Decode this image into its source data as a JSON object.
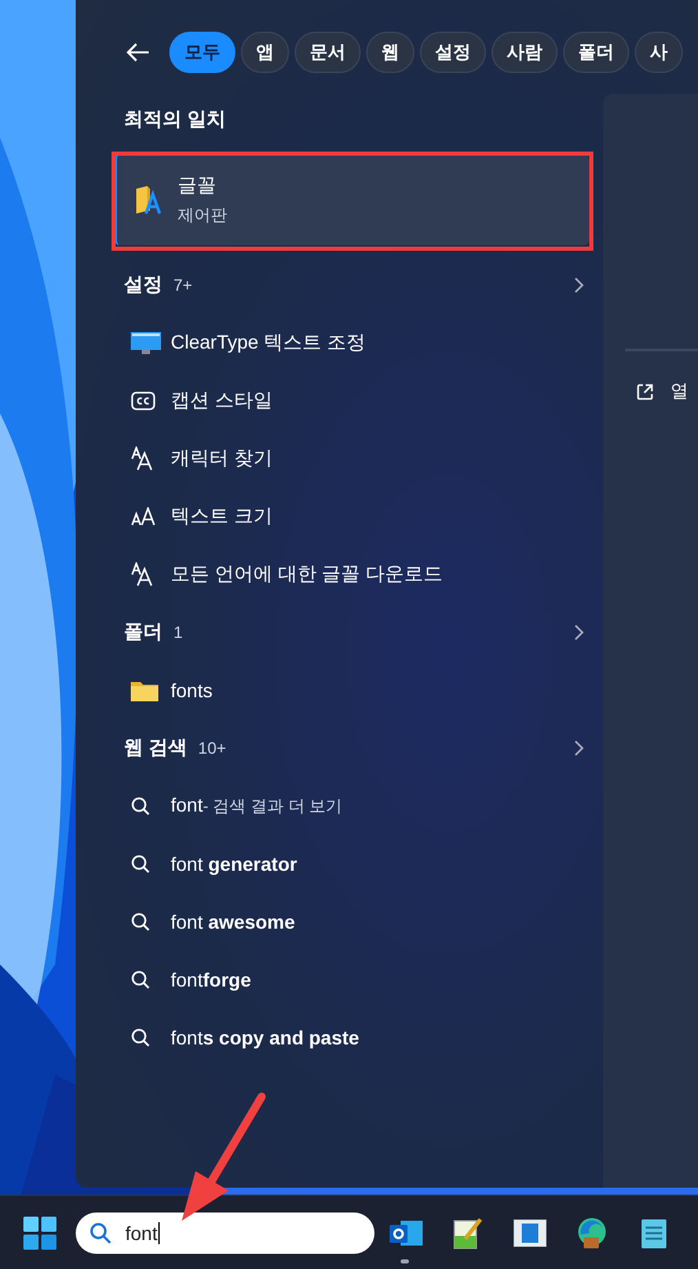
{
  "filters": [
    {
      "label": "모두",
      "selected": true
    },
    {
      "label": "앱",
      "selected": false
    },
    {
      "label": "문서",
      "selected": false
    },
    {
      "label": "웹",
      "selected": false
    },
    {
      "label": "설정",
      "selected": false
    },
    {
      "label": "사람",
      "selected": false
    },
    {
      "label": "폴더",
      "selected": false
    },
    {
      "label": "사",
      "selected": false
    }
  ],
  "best_match": {
    "heading": "최적의 일치",
    "title": "글꼴",
    "subtitle": "제어판"
  },
  "sections": [
    {
      "heading": "설정",
      "count": "7+",
      "items": [
        {
          "kind": "monitor",
          "label": "ClearType 텍스트 조정"
        },
        {
          "kind": "captions",
          "label": "캡션 스타일"
        },
        {
          "kind": "font",
          "label": "캐릭터 찾기"
        },
        {
          "kind": "font-size",
          "label": "텍스트 크기"
        },
        {
          "kind": "font",
          "label": "모든 언어에 대한 글꼴 다운로드"
        }
      ]
    },
    {
      "heading": "폴더",
      "count": "1",
      "items": [
        {
          "kind": "folder",
          "label": "fonts"
        }
      ]
    },
    {
      "heading": "웹 검색",
      "count": "10+",
      "items": [
        {
          "kind": "search",
          "label": "font",
          "suffix": "- 검색 결과 더 보기"
        },
        {
          "kind": "search",
          "label": "font **generator**"
        },
        {
          "kind": "search",
          "label": "font **awesome**"
        },
        {
          "kind": "search",
          "label": "font**forge**"
        },
        {
          "kind": "search",
          "label": "font**s copy and paste**"
        }
      ]
    }
  ],
  "preview": {
    "link_label": "열"
  },
  "taskbar": {
    "search": {
      "value": "font"
    },
    "apps": [
      {
        "kind": "mail",
        "running": true
      },
      {
        "kind": "editor",
        "running": false
      },
      {
        "kind": "window",
        "running": false
      },
      {
        "kind": "browser",
        "running": false
      },
      {
        "kind": "notes",
        "running": false
      }
    ]
  }
}
